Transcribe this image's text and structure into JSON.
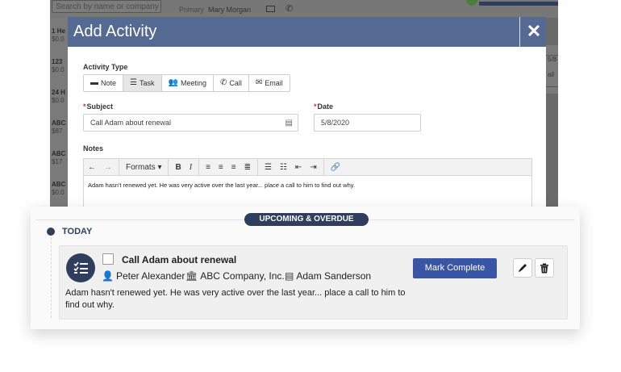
{
  "background": {
    "search_placeholder": "Search by name or company",
    "primary_label": "Primary",
    "primary_name": "Mary Morgan",
    "rows": [
      {
        "title": "1 He",
        "amount": "$0.0"
      },
      {
        "title": "123",
        "amount": "$0.0"
      },
      {
        "title": "24 H",
        "amount": "$0.0"
      },
      {
        "title": "ABC",
        "amount": "$87"
      },
      {
        "title": "ABC",
        "amount": "$17"
      },
      {
        "title": "ABC",
        "amount": "$0.0"
      }
    ],
    "right_snippets": [
      "5/8",
      "ail"
    ]
  },
  "modal": {
    "title": "Add Activity",
    "close_glyph": "✕",
    "activity_type_label": "Activity Type",
    "types": [
      {
        "label": "Note",
        "icon": "note-icon",
        "active": false
      },
      {
        "label": "Task",
        "icon": "task-list-icon",
        "active": true
      },
      {
        "label": "Meeting",
        "icon": "people-icon",
        "active": false
      },
      {
        "label": "Call",
        "icon": "phone-icon",
        "active": false
      },
      {
        "label": "Email",
        "icon": "envelope-icon",
        "active": false
      }
    ],
    "subject_label": "Subject",
    "subject_value": "Call Adam about renewal",
    "date_label": "Date",
    "date_value": "5/8/2020",
    "required_marker": "*",
    "notes_label": "Notes",
    "toolbar": {
      "formats_label": "Formats",
      "bold": "B",
      "italic": "I"
    },
    "notes_text": "Adam hasn't renewed yet.  He was very active over the last year... place a call to him to find out why."
  },
  "section": {
    "header": "UPCOMING & OVERDUE",
    "group_label": "TODAY"
  },
  "activity": {
    "title": "Call Adam about renewal",
    "owner": "Peter Alexander",
    "company": "ABC Company, Inc.",
    "contact": "Adam Sanderson",
    "notes": "Adam hasn't renewed yet.  He was very active over the last year... place a call to him to find out why.",
    "mark_complete_label": "Mark Complete"
  },
  "colors": {
    "modal_header": "#556a93",
    "navy": "#2f3e5d",
    "primary_button": "#3a54a6",
    "required": "#c0392b"
  }
}
